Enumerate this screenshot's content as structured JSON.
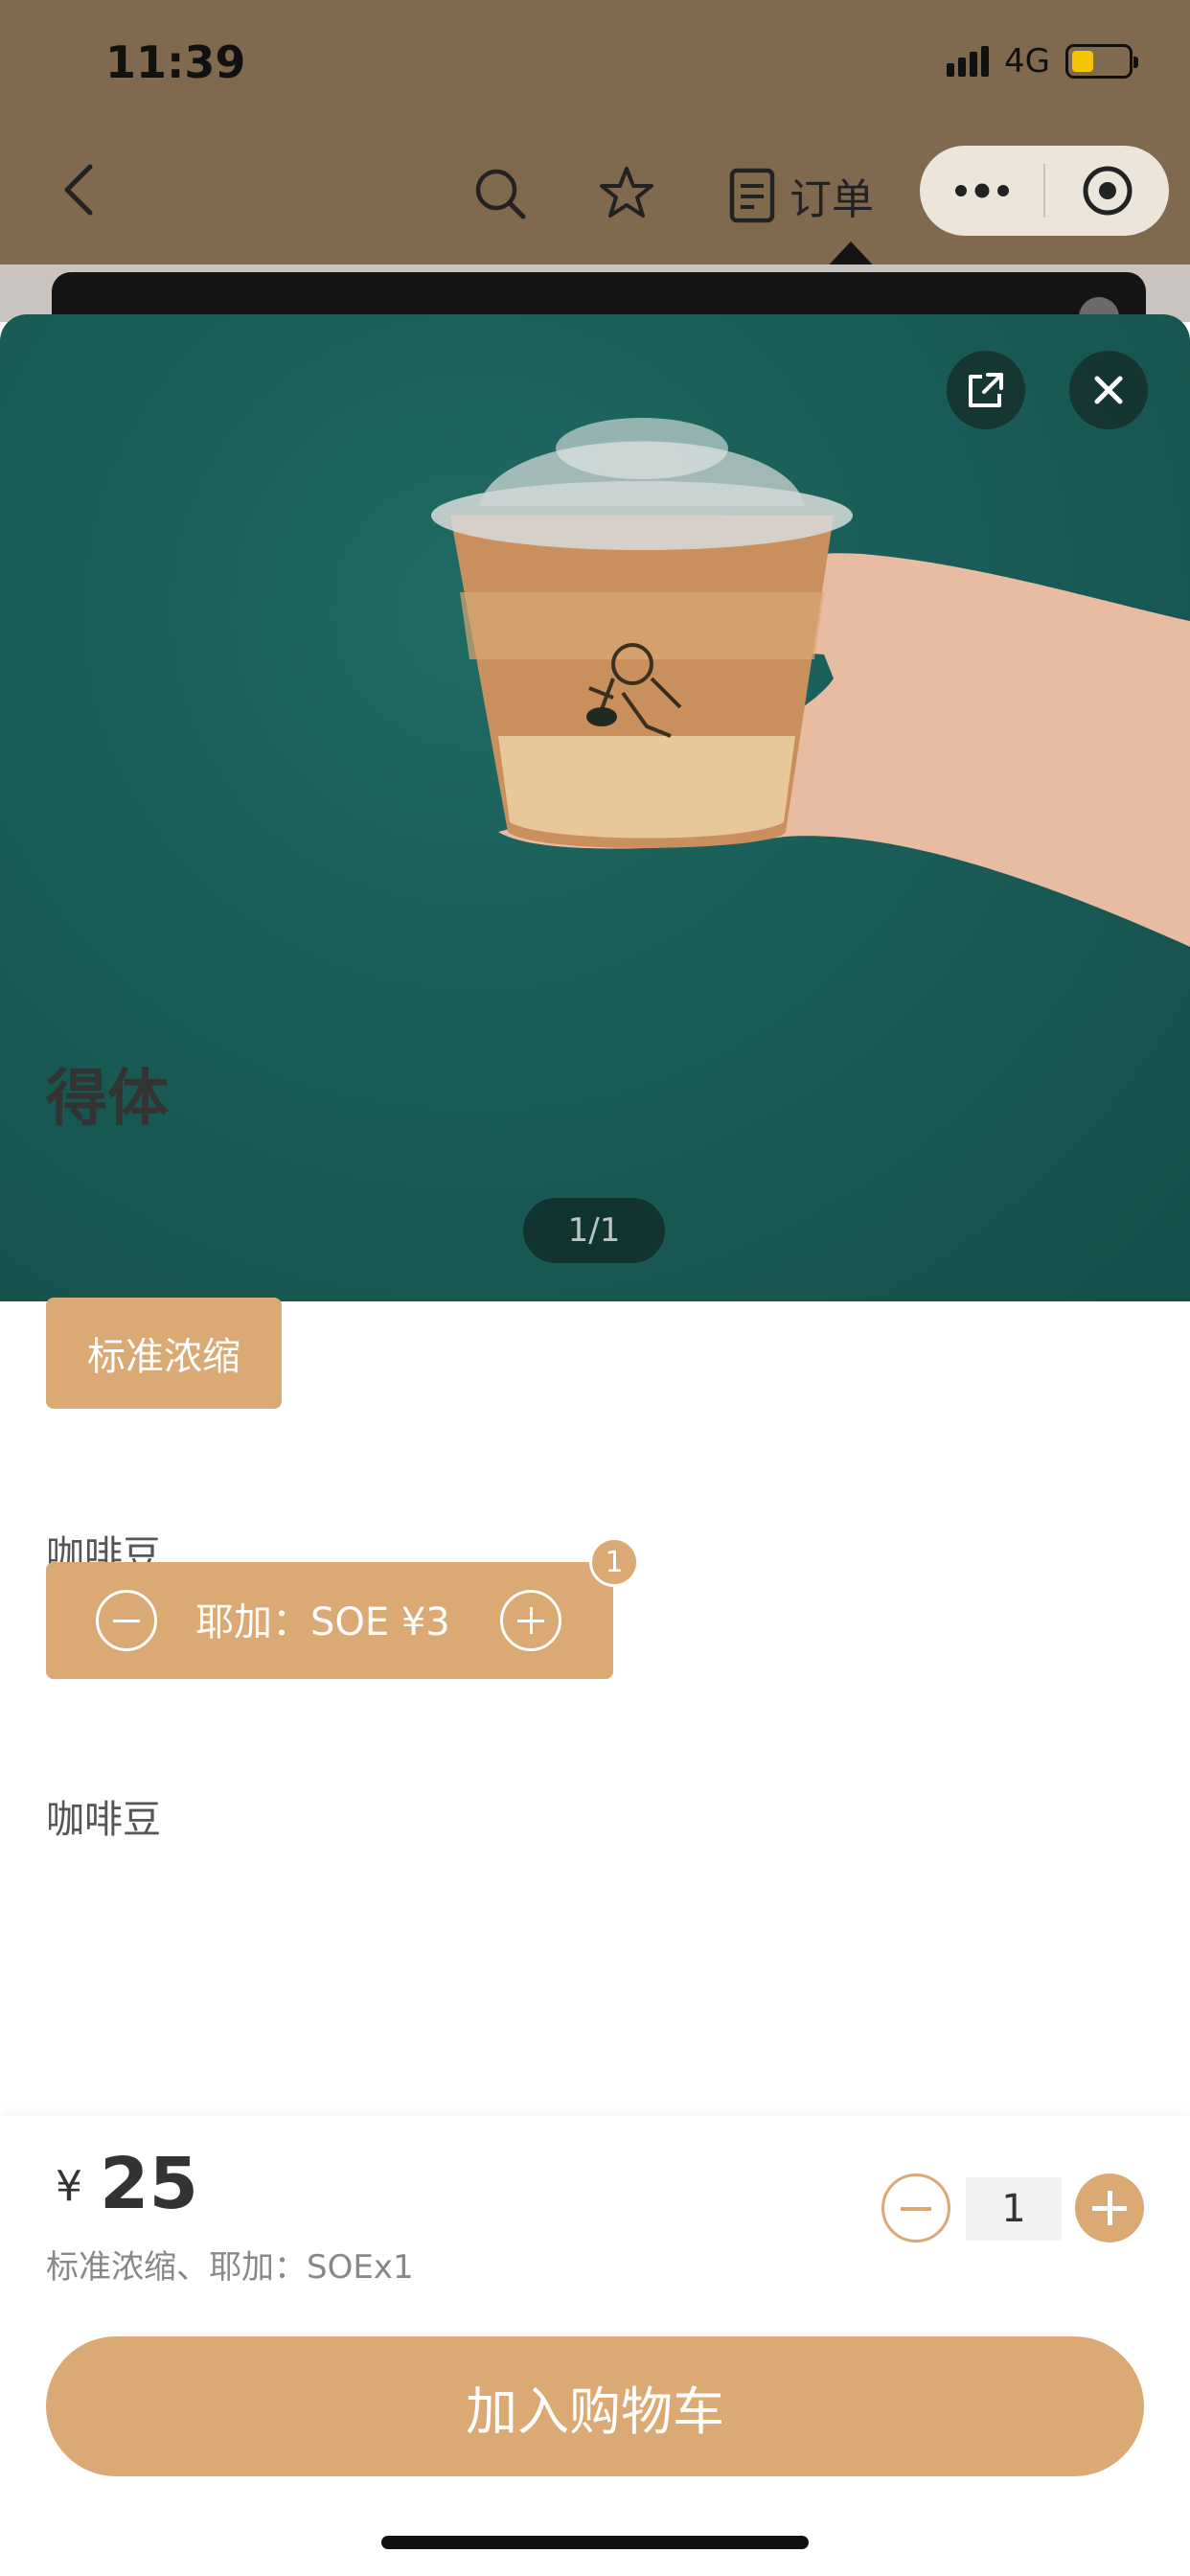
{
  "status": {
    "time": "11:39",
    "network": "4G"
  },
  "nav": {
    "order_label": "订单"
  },
  "photo": {
    "counter": "1/1"
  },
  "product": {
    "name": "得体",
    "groups": [
      {
        "label": "咖啡豆",
        "option": "标准浓缩"
      },
      {
        "label": "咖啡豆",
        "addon": "耶加：SOE ¥3",
        "addon_count": "1"
      }
    ]
  },
  "purchase": {
    "currency": "¥",
    "price": "25",
    "description": "标准浓缩、耶加：SOEx1",
    "quantity": "1",
    "add_to_cart": "加入购物车"
  },
  "colors": {
    "accent": "#dba973",
    "header_bg": "#7f6a4f",
    "photo_bg": "#1a5e58"
  },
  "icons": [
    "back-icon",
    "search-icon",
    "star-icon",
    "order-icon",
    "more-icon",
    "target-icon",
    "share-icon",
    "close-icon"
  ]
}
